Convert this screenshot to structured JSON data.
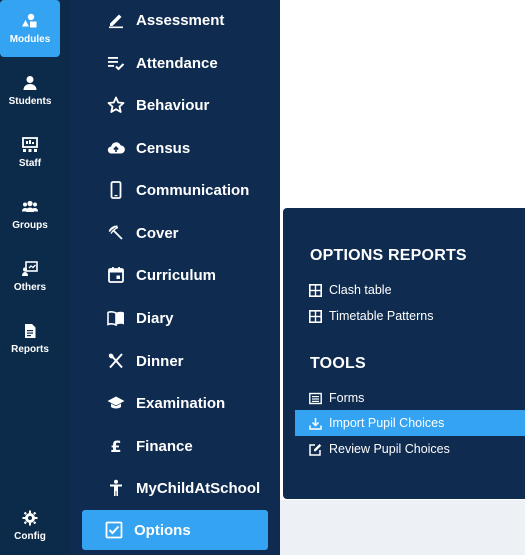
{
  "rail": {
    "items": [
      {
        "label": "Modules",
        "icon": "shapes-icon"
      },
      {
        "label": "Students",
        "icon": "person-icon"
      },
      {
        "label": "Staff",
        "icon": "staff-board-icon"
      },
      {
        "label": "Groups",
        "icon": "groups-icon"
      },
      {
        "label": "Others",
        "icon": "others-icon"
      },
      {
        "label": "Reports",
        "icon": "document-icon"
      }
    ],
    "config_label": "Config"
  },
  "modules": {
    "items": [
      {
        "label": "Assessment",
        "icon": "pencil-icon"
      },
      {
        "label": "Attendance",
        "icon": "checklist-icon"
      },
      {
        "label": "Behaviour",
        "icon": "star-outline-icon"
      },
      {
        "label": "Census",
        "icon": "cloud-upload-icon"
      },
      {
        "label": "Communication",
        "icon": "phone-icon"
      },
      {
        "label": "Cover",
        "icon": "umbrella-icon"
      },
      {
        "label": "Curriculum",
        "icon": "calendar-icon"
      },
      {
        "label": "Diary",
        "icon": "book-icon"
      },
      {
        "label": "Dinner",
        "icon": "cutlery-icon"
      },
      {
        "label": "Examination",
        "icon": "graduation-cap-icon"
      },
      {
        "label": "Finance",
        "icon": "pound-icon"
      },
      {
        "label": "MyChildAtSchool",
        "icon": "child-icon"
      },
      {
        "label": "Options",
        "icon": "checkbox-icon"
      }
    ],
    "active": "Options"
  },
  "popup": {
    "options_reports_title": "OPTIONS REPORTS",
    "options_reports": [
      {
        "label": "Clash table",
        "icon": "table-icon"
      },
      {
        "label": "Timetable Patterns",
        "icon": "table-icon"
      }
    ],
    "tools_title": "TOOLS",
    "tools": [
      {
        "label": "Forms",
        "icon": "list-icon"
      },
      {
        "label": "Import Pupil Choices",
        "icon": "download-icon"
      },
      {
        "label": "Review Pupil Choices",
        "icon": "edit-icon"
      }
    ],
    "active": "Import Pupil Choices"
  },
  "colors": {
    "rail_bg": "#0c2a4a",
    "sidebar_bg": "#0f2b50",
    "accent": "#33a3f2",
    "page_bg": "#edf0f4"
  }
}
